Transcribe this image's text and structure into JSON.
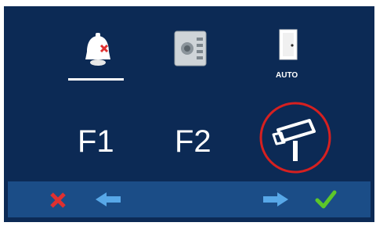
{
  "menu": {
    "items": [
      {
        "name": "mute-bell",
        "selected": true
      },
      {
        "name": "intercom-panel",
        "selected": false
      },
      {
        "name": "auto-door",
        "label": "AUTO",
        "selected": false
      },
      {
        "name": "f1",
        "label": "F1"
      },
      {
        "name": "f2",
        "label": "F2"
      },
      {
        "name": "camera",
        "highlighted": true
      }
    ]
  },
  "bottom_bar": {
    "buttons": [
      "close-icon",
      "arrow-left-icon",
      "arrow-right-icon",
      "checkmark-icon"
    ]
  },
  "colors": {
    "screen_bg": "#0c2a55",
    "bar_bg": "#1b4d87",
    "highlight_ring": "#d62020",
    "accent_x": "#e03030",
    "accent_check": "#5cc72a",
    "arrow": "#58a8e8"
  }
}
